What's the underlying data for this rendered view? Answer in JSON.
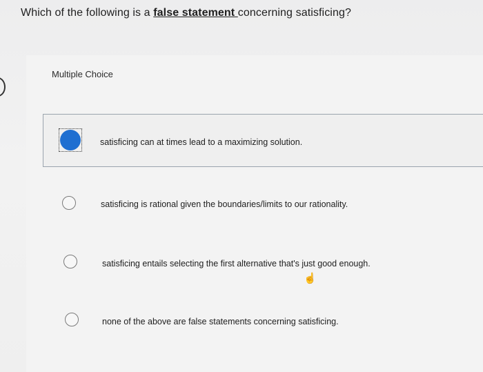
{
  "question": {
    "prefix": "Which of the following is a ",
    "emphasis": "false statement ",
    "suffix": "concerning satisficing?"
  },
  "section_label": "Multiple Choice",
  "options": [
    {
      "text": "satisficing can at times lead to a maximizing solution.",
      "selected": true
    },
    {
      "text": "satisficing is rational given the boundaries/limits to our rationality.",
      "selected": false
    },
    {
      "text": "satisficing entails selecting the first alternative that's just good enough.",
      "selected": false
    },
    {
      "text": "none of the above are false statements concerning satisficing.",
      "selected": false
    }
  ],
  "icons": {
    "cursor": "hand-pointer-icon",
    "radio_selected": "radio-selected-icon",
    "radio_unselected": "radio-unselected-icon"
  },
  "colors": {
    "selected_radio": "#1f6fd1",
    "selected_border": "#9aa3ad"
  }
}
